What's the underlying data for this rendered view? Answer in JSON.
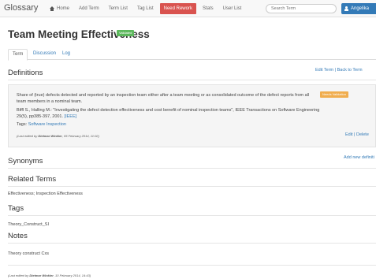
{
  "navbar": {
    "brand": "Glossary",
    "items": [
      "Home",
      "Add Term",
      "Term List",
      "Tag List",
      "Need Rework",
      "Stats",
      "User List"
    ],
    "search_placeholder": "Search Term",
    "user": "Angelika"
  },
  "term": {
    "title": "Team Meeting Effectiveness",
    "status": "Validated"
  },
  "tabs": [
    "Term",
    "Discussion",
    "Log"
  ],
  "definitions": {
    "heading": "Definitions",
    "edit_term": "Edit Term",
    "separator": " | ",
    "back_to_term": "Back to Term",
    "text": "Share of (true) defects detected and reported by an inspection team either after a team meeting or as consolidated outcome of the defect reports from all team members in a nominal team.",
    "source_prefix": "Biffl S., Halling M.: \"Investigating the defect detection effectiveness and cost benefit of nominal inspection teams\", IEEE Transactions on Software Engineering 29(5), pp385-397, 2001. ",
    "source_link": "[IEEE]",
    "tags_label": "Tags: ",
    "tag": "Software Inspection",
    "edited_prefix": "(Last edited by ",
    "edited_by": "Dietmar Winkler",
    "edited_suffix": ", 05 February 2014, 11:02)",
    "badge": "Needs Validation",
    "edit": "Edit",
    "delete": "Delete"
  },
  "synonyms": {
    "heading": "Synonyms",
    "add": "Add new definiti"
  },
  "related": {
    "heading": "Related Terms",
    "links": "Effectiveness; Inspection Effectiveness"
  },
  "tags": {
    "heading": "Tags",
    "link": "Theory_Construct_SI"
  },
  "notes": {
    "heading": "Notes",
    "text": "Theory construct Cxs"
  },
  "footer": {
    "edited_prefix": "(Last edited by ",
    "edited_by": "Dietmar Winkler",
    "edited_suffix": ", 10 February 2014, 14:43)"
  }
}
